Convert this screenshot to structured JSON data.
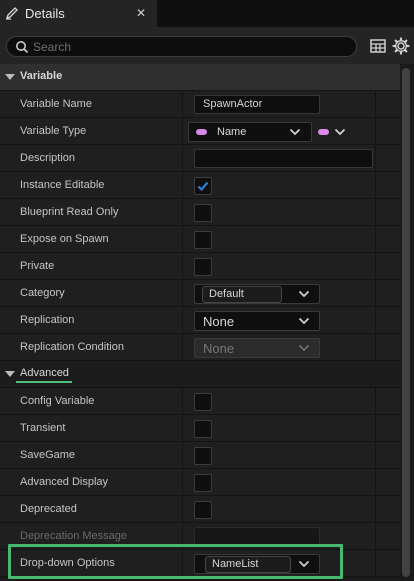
{
  "tab": {
    "icon": "pencil-icon",
    "label": "Details",
    "close": "✕"
  },
  "toolbar": {
    "search_placeholder": "Search",
    "table_icon": "table-view-icon",
    "settings_icon": "gear-icon"
  },
  "sections": {
    "variable": "Variable",
    "advanced": "Advanced"
  },
  "variable_rows": {
    "name": {
      "label": "Variable Name",
      "value": "SpawnActor"
    },
    "type": {
      "label": "Variable Type",
      "value": "Name"
    },
    "description": {
      "label": "Description",
      "value": ""
    },
    "instance_editable": {
      "label": "Instance Editable",
      "checked": true
    },
    "blueprint_read_only": {
      "label": "Blueprint Read Only",
      "checked": false
    },
    "expose_on_spawn": {
      "label": "Expose on Spawn",
      "checked": false
    },
    "private": {
      "label": "Private",
      "checked": false
    },
    "category": {
      "label": "Category",
      "value": "Default"
    },
    "replication": {
      "label": "Replication",
      "value": "None"
    },
    "replication_condition": {
      "label": "Replication Condition",
      "value": "None"
    }
  },
  "advanced_rows": {
    "config_variable": {
      "label": "Config Variable",
      "checked": false
    },
    "transient": {
      "label": "Transient",
      "checked": false
    },
    "savegame": {
      "label": "SaveGame",
      "checked": false
    },
    "advanced_display": {
      "label": "Advanced Display",
      "checked": false
    },
    "deprecated": {
      "label": "Deprecated",
      "checked": false
    },
    "deprecation_message": {
      "label": "Deprecation Message",
      "value": ""
    },
    "dropdown_options": {
      "label": "Drop-down Options",
      "value": "NameList"
    }
  },
  "colors": {
    "accent_check": "#2f7fd6",
    "type_pill": "#d98ae8",
    "highlight": "#48b870"
  }
}
